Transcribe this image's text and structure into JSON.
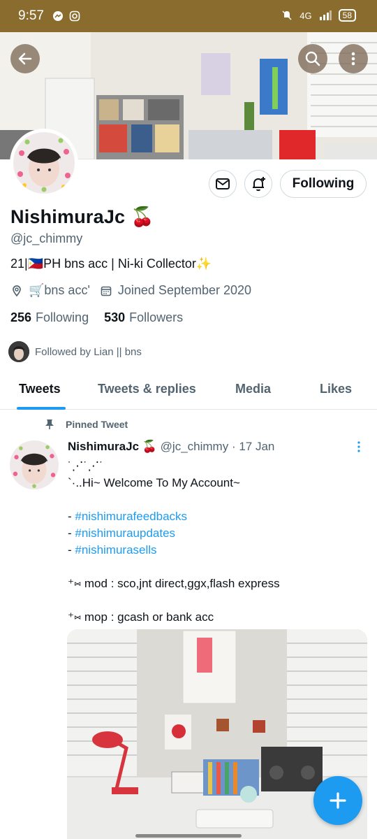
{
  "status_bar": {
    "time": "9:57",
    "network": "4G",
    "battery": "58"
  },
  "profile": {
    "name": "NishimuraJc",
    "name_emoji": "🍒",
    "handle": "@jc_chimmy",
    "bio_text": "21|🇵🇭PH bns acc | Ni-ki Collector✨",
    "location": "🛒bns acc'",
    "joined": "Joined September 2020",
    "following_count": "256",
    "following_label": "Following",
    "followers_count": "530",
    "followers_label": "Followers",
    "followed_by": "Followed by Lian || bns"
  },
  "actions": {
    "following_button": "Following"
  },
  "tabs": [
    {
      "label": "Tweets"
    },
    {
      "label": "Tweets & replies"
    },
    {
      "label": "Media"
    },
    {
      "label": "Likes"
    }
  ],
  "pinned_tweet": {
    "pinned_label": "Pinned Tweet",
    "author_name": "NishimuraJc 🍒",
    "author_meta": "@jc_chimmy · 17 Jan",
    "lines": {
      "l1": "˙⋰˙⋰˙",
      "l2": "`·..Hi~ Welcome To My Account~",
      "h1_prefix": "- ",
      "h1": "#nishimurafeedbacks",
      "h2_prefix": "- ",
      "h2": "#nishimuraupdates",
      "h3_prefix": "- ",
      "h3": "#nishimurasells",
      "mod": "⁺⑅ mod : sco,jnt direct,ggx,flash express",
      "mop": "⁺⑅ mop : gcash or bank acc"
    }
  },
  "colors": {
    "accent": "#1d9bf0",
    "status_bar": "#8a6d2e",
    "secondary_text": "#536471"
  },
  "icons": {
    "back": "back-arrow-icon",
    "search": "search-icon",
    "more": "more-vertical-icon",
    "message": "envelope-icon",
    "notify": "bell-plus-icon",
    "location": "location-pin-icon",
    "calendar": "calendar-icon",
    "pin": "pin-icon",
    "compose": "plus-icon"
  }
}
